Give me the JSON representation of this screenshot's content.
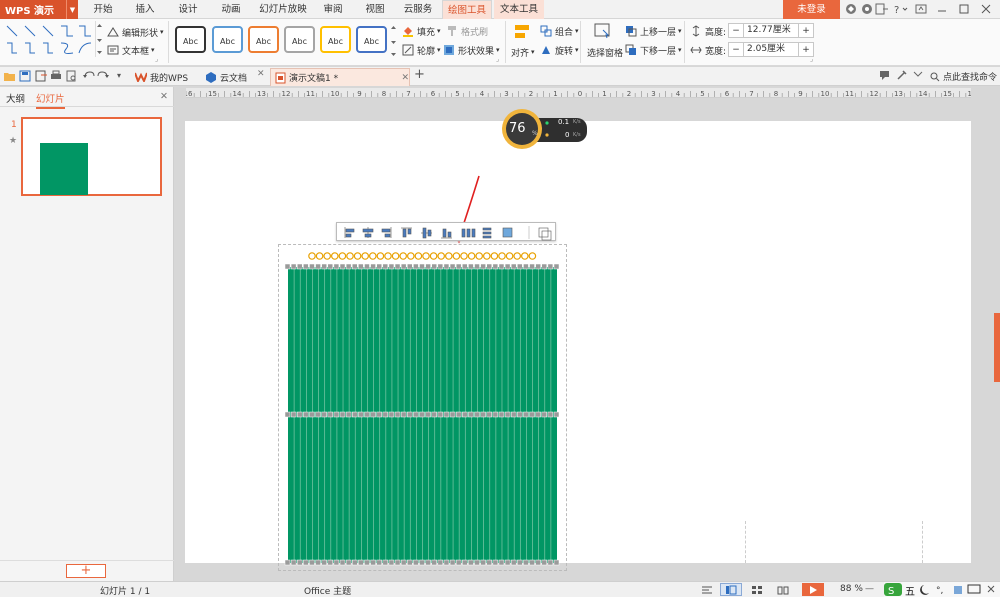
{
  "app": {
    "title": "WPS 演示",
    "login": "未登录"
  },
  "menu": {
    "tabs": [
      "开始",
      "插入",
      "设计",
      "动画",
      "幻灯片放映",
      "审阅",
      "视图",
      "云服务",
      "绘图工具",
      "文本工具"
    ]
  },
  "ribbon": {
    "edit_shape": "编辑形状",
    "textbox": "文本框",
    "styles": [
      "Abc",
      "Abc",
      "Abc",
      "Abc",
      "Abc",
      "Abc"
    ],
    "style_colors": [
      "#333333",
      "#5b9bd5",
      "#ed7d31",
      "#a5a5a5",
      "#ffc000",
      "#4472c4"
    ],
    "fill": "填充",
    "format_painter": "格式刷",
    "outline": "轮廓",
    "shape_effect": "形状效果",
    "group": "组合",
    "align": "对齐",
    "rotate": "旋转",
    "selection_pane": "选择窗格",
    "bring_forward": "上移一层",
    "send_backward": "下移一层",
    "height_label": "高度:",
    "height_value": "12.77厘米",
    "width_label": "宽度:",
    "width_value": "2.05厘米",
    "minus": "−",
    "plus": "+"
  },
  "docbar": {
    "tabs": [
      "我的WPS",
      "云文档",
      "演示文稿1 *"
    ],
    "add": "+",
    "search": "点此查找命令"
  },
  "panel": {
    "outline_tab": "大纲",
    "slides_tab": "幻灯片",
    "slide_number": "1",
    "star": "★",
    "close": "✕",
    "add": "+"
  },
  "ruler": {
    "labels": [
      "16",
      "15",
      "14",
      "13",
      "12",
      "11",
      "10",
      "9",
      "8",
      "7",
      "6",
      "5",
      "4",
      "3",
      "2",
      "1",
      "0",
      "1",
      "2",
      "3",
      "4",
      "5",
      "6",
      "7",
      "8",
      "9",
      "10",
      "11",
      "12",
      "13",
      "14",
      "15",
      "16"
    ]
  },
  "speed": {
    "percent": "76",
    "percent_unit": "%",
    "up": "0.1",
    "up_unit": "K/s",
    "down": "0",
    "down_unit": "K/s"
  },
  "status": {
    "slide_info": "幻灯片 1 / 1",
    "theme": "Office 主题",
    "zoom": "88 %",
    "ime": "五"
  },
  "colors": {
    "accent": "#e9673d",
    "shape_fill": "#019664",
    "tab_text": "#d9532b"
  },
  "shape": {
    "stripe_count": 44
  }
}
